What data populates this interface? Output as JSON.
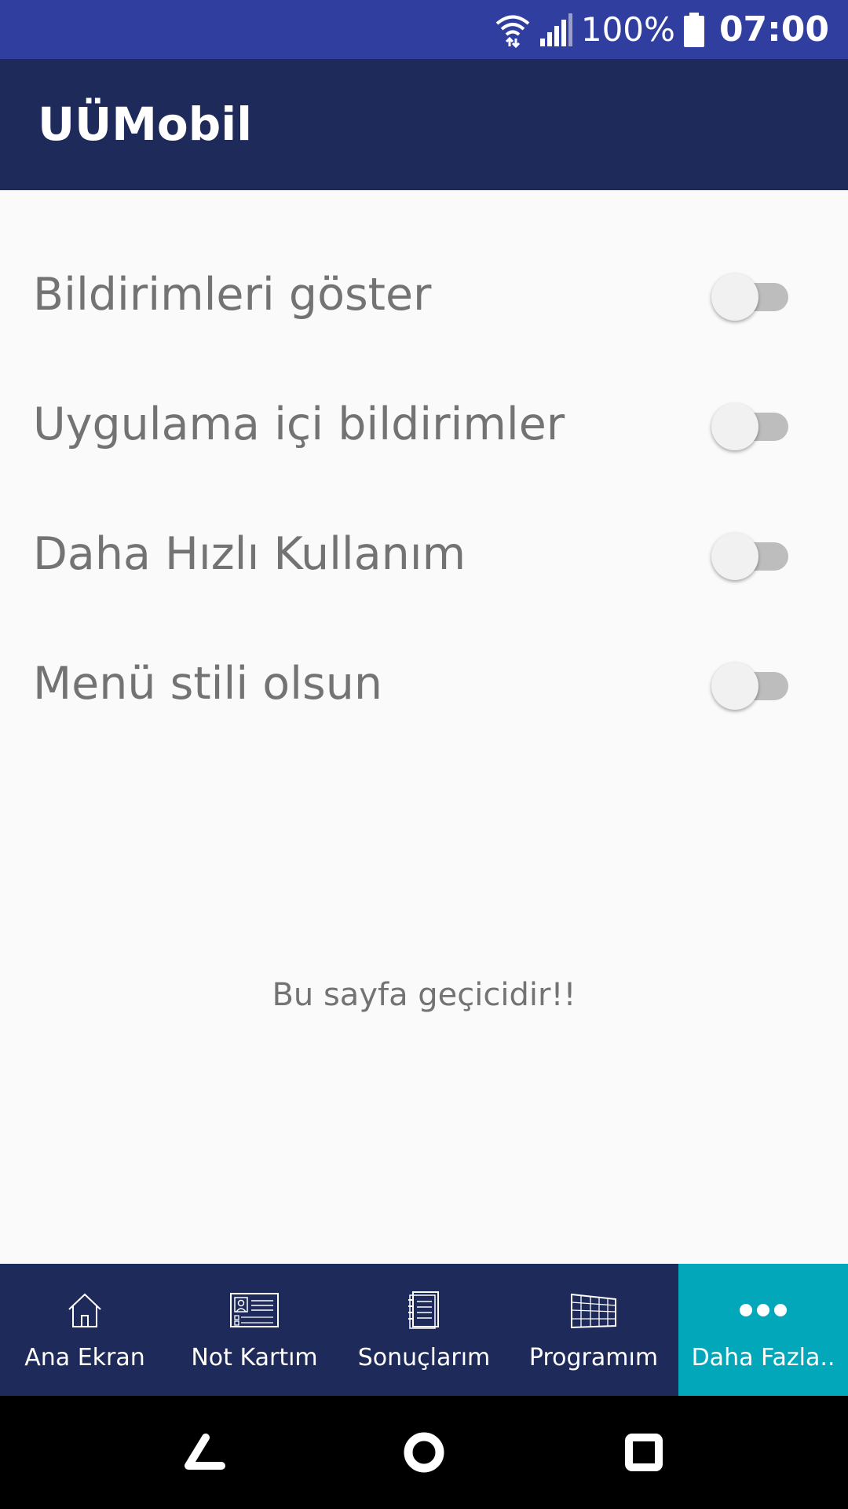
{
  "status_bar": {
    "battery_percent": "100%",
    "time": "07:00",
    "icons": [
      "wifi-icon",
      "signal-icon",
      "battery-icon"
    ]
  },
  "app_bar": {
    "title": "UÜMobil"
  },
  "settings": [
    {
      "label": "Bildirimleri göster",
      "enabled": false
    },
    {
      "label": "Uygulama içi bildirimler",
      "enabled": false
    },
    {
      "label": "Daha Hızlı Kullanım",
      "enabled": false
    },
    {
      "label": "Menü stili olsun",
      "enabled": false
    }
  ],
  "note": "Bu sayfa geçicidir!!",
  "bottom_nav": [
    {
      "label": "Ana Ekran",
      "icon": "home-icon",
      "active": false
    },
    {
      "label": "Not Kartım",
      "icon": "id-card-icon",
      "active": false
    },
    {
      "label": "Sonuçlarım",
      "icon": "notebook-icon",
      "active": false
    },
    {
      "label": "Programım",
      "icon": "schedule-grid-icon",
      "active": false
    },
    {
      "label": "Daha Fazla..",
      "icon": "more-dots-icon",
      "active": true
    }
  ],
  "system_nav": [
    "back-icon",
    "home-circle-icon",
    "recents-icon"
  ],
  "colors": {
    "status_bar": "#303f9f",
    "app_bar": "#1e2a5a",
    "active_tab": "#03a7ba",
    "text_gray": "#737373"
  }
}
